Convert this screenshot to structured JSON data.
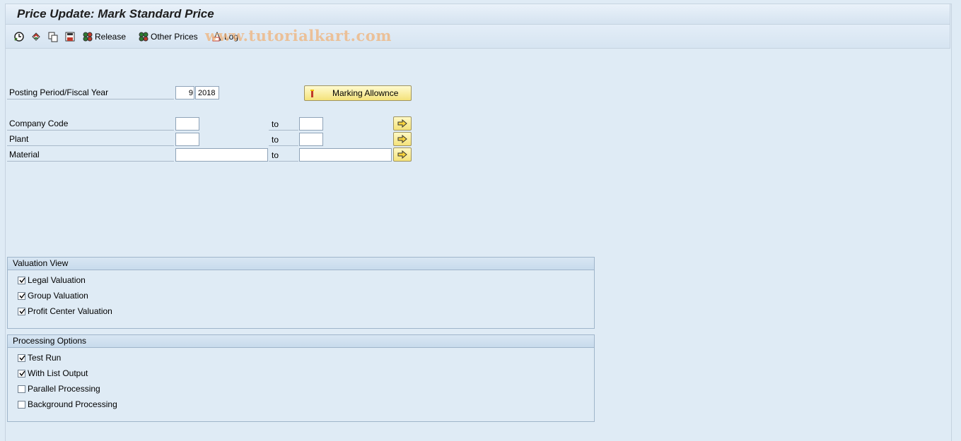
{
  "window": {
    "title": "Price Update: Mark Standard Price"
  },
  "toolbar": {
    "items": [
      {
        "icon": "execute-icon",
        "label": ""
      },
      {
        "icon": "get-variant-icon",
        "label": ""
      },
      {
        "icon": "copy-icon",
        "label": ""
      },
      {
        "icon": "save-icon",
        "label": ""
      },
      {
        "icon": "release-icon",
        "label": "Release"
      },
      {
        "icon": "other-prices-icon",
        "label": "Other Prices"
      },
      {
        "icon": "log-icon",
        "label": "Log"
      }
    ]
  },
  "watermark": "www.tutorialkart.com",
  "form": {
    "period_label": "Posting Period/Fiscal Year",
    "period_value": "9",
    "year_value": "2018",
    "marking_button": "Marking Allownce",
    "to_label": "to",
    "rows": [
      {
        "label": "Company Code",
        "from": "",
        "to": ""
      },
      {
        "label": "Plant",
        "from": "",
        "to": ""
      },
      {
        "label": "Material",
        "from": "",
        "to": ""
      }
    ]
  },
  "valuation_view": {
    "title": "Valuation View",
    "options": [
      {
        "label": "Legal Valuation",
        "checked": true
      },
      {
        "label": "Group Valuation",
        "checked": true
      },
      {
        "label": "Profit Center Valuation",
        "checked": true
      }
    ]
  },
  "processing_options": {
    "title": "Processing Options",
    "options": [
      {
        "label": "Test Run",
        "checked": true
      },
      {
        "label": "With List Output",
        "checked": true
      },
      {
        "label": "Parallel Processing",
        "checked": false
      },
      {
        "label": "Background Processing",
        "checked": false
      }
    ]
  }
}
